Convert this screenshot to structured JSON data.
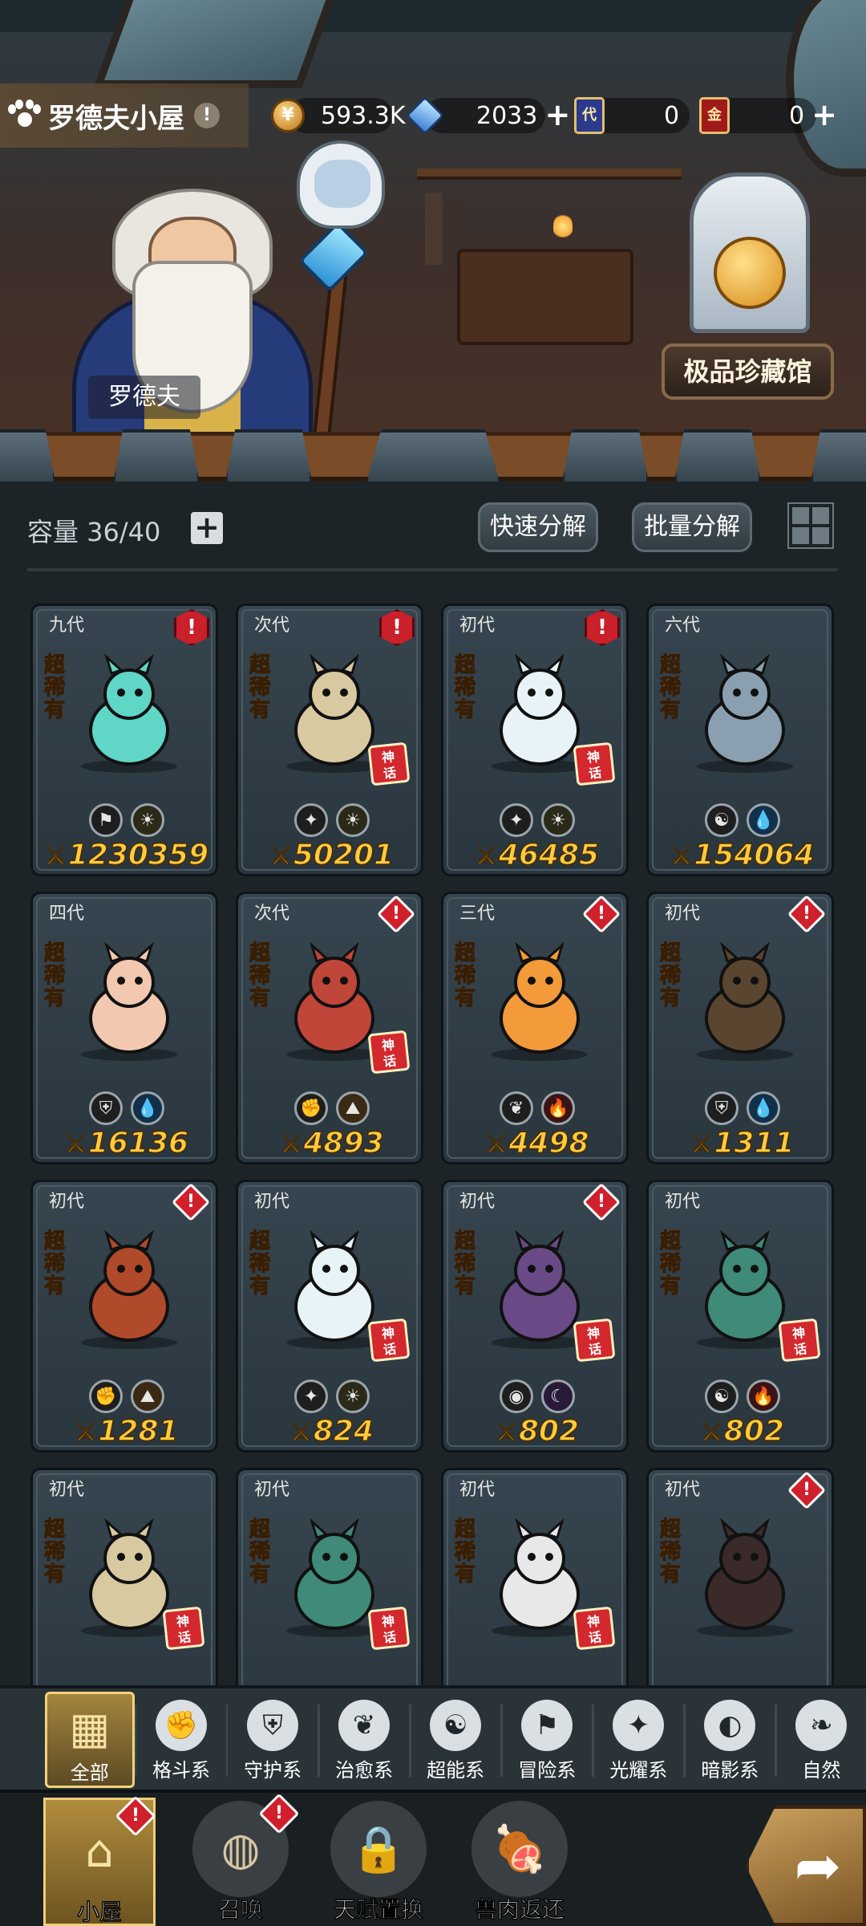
{
  "header": {
    "title": "罗德夫小屋",
    "info_icon": "!",
    "resources": [
      {
        "icon": "coin-icon",
        "value": "593.3K",
        "plus": false
      },
      {
        "icon": "gem-icon",
        "value": "2033",
        "plus": true
      },
      {
        "icon": "card-icon",
        "label": "代",
        "value": "0",
        "plus": false
      },
      {
        "icon": "card-icon",
        "label": "金",
        "value": "0",
        "plus": true
      }
    ]
  },
  "scene": {
    "npc_name": "罗德夫",
    "collection_button": "极品珍藏馆"
  },
  "toolbar": {
    "capacity": "容量 36/40",
    "quick_decompose": "快速分解",
    "batch_decompose": "批量分解"
  },
  "pets": [
    {
      "gen": "九代",
      "rarity": "超稀有",
      "alert": "big",
      "myth": false,
      "affinities": [
        "adventure-icon",
        "light-icon"
      ],
      "power": "1230359",
      "color": "#5fd6c6"
    },
    {
      "gen": "次代",
      "rarity": "超稀有",
      "alert": "big",
      "myth": true,
      "affinities": [
        "radiant-icon",
        "light-icon"
      ],
      "power": "50201",
      "color": "#d9c9a0"
    },
    {
      "gen": "初代",
      "rarity": "超稀有",
      "alert": "big",
      "myth": true,
      "affinities": [
        "radiant-icon",
        "light-icon"
      ],
      "power": "46485",
      "color": "#e8f3f8"
    },
    {
      "gen": "六代",
      "rarity": "超稀有",
      "alert": "none",
      "myth": false,
      "affinities": [
        "psychic-icon",
        "water-icon"
      ],
      "power": "154064",
      "color": "#8aa0b0"
    },
    {
      "gen": "四代",
      "rarity": "超稀有",
      "alert": "none",
      "myth": false,
      "affinities": [
        "guardian-icon",
        "water-icon"
      ],
      "power": "16136",
      "color": "#f2c8b0"
    },
    {
      "gen": "次代",
      "rarity": "超稀有",
      "alert": "small",
      "myth": true,
      "affinities": [
        "fighting-icon",
        "earth-icon"
      ],
      "power": "4893",
      "color": "#c0463a"
    },
    {
      "gen": "三代",
      "rarity": "超稀有",
      "alert": "small",
      "myth": false,
      "affinities": [
        "healing-icon",
        "fire-icon"
      ],
      "power": "4498",
      "color": "#f39a3a"
    },
    {
      "gen": "初代",
      "rarity": "超稀有",
      "alert": "small",
      "myth": false,
      "affinities": [
        "guardian-icon",
        "water-icon"
      ],
      "power": "1311",
      "color": "#5a4630"
    },
    {
      "gen": "初代",
      "rarity": "超稀有",
      "alert": "small",
      "myth": false,
      "affinities": [
        "fighting-icon",
        "earth-icon"
      ],
      "power": "1281",
      "color": "#b04a2a"
    },
    {
      "gen": "初代",
      "rarity": "超稀有",
      "alert": "none",
      "myth": true,
      "affinities": [
        "radiant-icon",
        "light-icon"
      ],
      "power": "824",
      "color": "#e8f3f8"
    },
    {
      "gen": "初代",
      "rarity": "超稀有",
      "alert": "small",
      "myth": true,
      "affinities": [
        "shadow-icon",
        "dark-icon"
      ],
      "power": "802",
      "color": "#6a4a86"
    },
    {
      "gen": "初代",
      "rarity": "超稀有",
      "alert": "none",
      "myth": true,
      "affinities": [
        "psychic-icon",
        "fire-icon"
      ],
      "power": "802",
      "color": "#3f8a78"
    },
    {
      "gen": "初代",
      "rarity": "超稀有",
      "alert": "none",
      "myth": true,
      "affinities": [],
      "power": "",
      "color": "#d9c9a0"
    },
    {
      "gen": "初代",
      "rarity": "超稀有",
      "alert": "none",
      "myth": true,
      "affinities": [],
      "power": "",
      "color": "#3f8a78"
    },
    {
      "gen": "初代",
      "rarity": "超稀有",
      "alert": "none",
      "myth": true,
      "affinities": [],
      "power": "",
      "color": "#e8e8e8"
    },
    {
      "gen": "初代",
      "rarity": "超稀有",
      "alert": "small",
      "myth": false,
      "affinities": [],
      "power": "",
      "color": "#3a2a2a"
    }
  ],
  "filters": [
    {
      "label": "全部",
      "icon": "all-icon",
      "glyph": "▦",
      "active": true
    },
    {
      "label": "格斗系",
      "icon": "fighting-icon",
      "glyph": "✊",
      "active": false
    },
    {
      "label": "守护系",
      "icon": "guardian-icon",
      "glyph": "⛨",
      "active": false
    },
    {
      "label": "治愈系",
      "icon": "healing-icon",
      "glyph": "❦",
      "active": false
    },
    {
      "label": "超能系",
      "icon": "psychic-icon",
      "glyph": "☯",
      "active": false
    },
    {
      "label": "冒险系",
      "icon": "adventure-icon",
      "glyph": "⚑",
      "active": false
    },
    {
      "label": "光耀系",
      "icon": "radiant-icon",
      "glyph": "✦",
      "active": false
    },
    {
      "label": "暗影系",
      "icon": "shadow-icon",
      "glyph": "◐",
      "active": false
    },
    {
      "label": "自然",
      "icon": "nature-icon",
      "glyph": "❧",
      "active": false
    }
  ],
  "bottom_nav": [
    {
      "label": "小屋",
      "icon": "house-icon",
      "glyph": "⌂",
      "active": true,
      "alert": true
    },
    {
      "label": "召唤",
      "icon": "egg-icon",
      "glyph": "◍",
      "active": false,
      "alert": true
    },
    {
      "label": "天赋置换",
      "icon": "lock-icon",
      "glyph": "🔒",
      "active": false,
      "alert": false
    },
    {
      "label": "兽肉返还",
      "icon": "meat-icon",
      "glyph": "🍖",
      "active": false,
      "alert": false
    }
  ],
  "next_button": "➦"
}
